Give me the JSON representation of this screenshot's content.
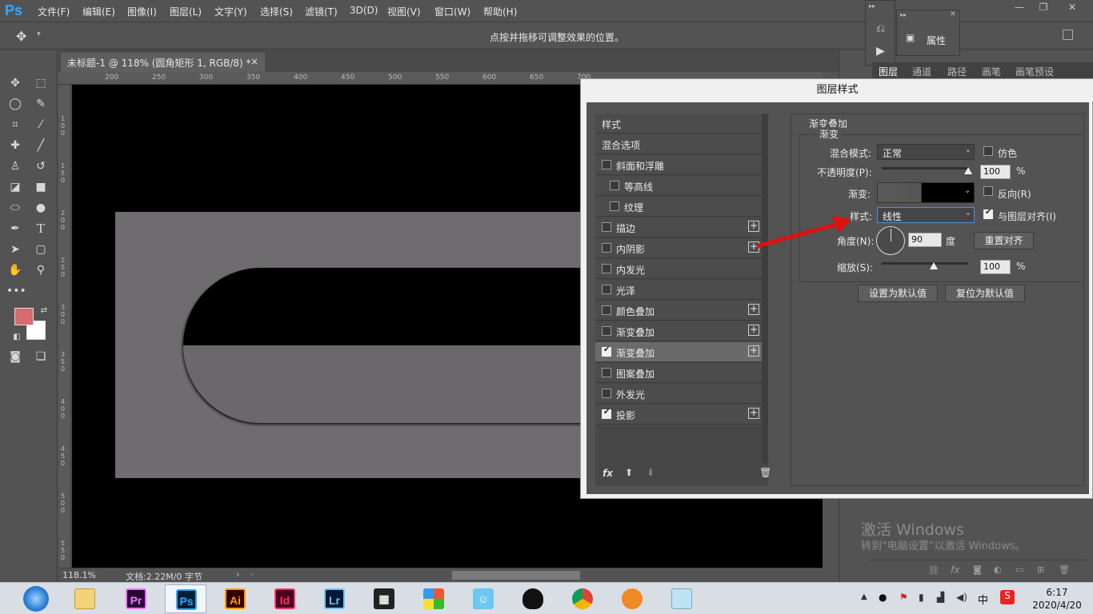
{
  "app": {
    "logo": "Ps"
  },
  "menu": [
    "文件(F)",
    "编辑(E)",
    "图像(I)",
    "图层(L)",
    "文字(Y)",
    "选择(S)",
    "滤镜(T)",
    "3D(D)",
    "视图(V)",
    "窗口(W)",
    "帮助(H)"
  ],
  "options_bar": {
    "hint": "点按并拖移可调整效果的位置。"
  },
  "document": {
    "tab_title": "未标题-1 @ 118% (圆角矩形 1, RGB/8) *",
    "close": "×"
  },
  "ruler_top": [
    "200",
    "250",
    "300",
    "350",
    "400",
    "450",
    "500",
    "550",
    "600",
    "650",
    "700"
  ],
  "ruler_left": [
    "1\n0\n0",
    "1\n5\n0",
    "2\n0\n0",
    "2\n5\n0",
    "3\n0\n0",
    "3\n5\n0",
    "4\n0\n0",
    "4\n5\n0",
    "5\n0\n0",
    "5\n5\n0"
  ],
  "status": {
    "zoom": "118.1%",
    "doc_info": "文档:2.22M/0 字节"
  },
  "panels": {
    "properties_label": "属性",
    "tabs": [
      "图层",
      "通道",
      "路径",
      "画笔",
      "画笔预设"
    ]
  },
  "dialog": {
    "title": "图层样式",
    "style_list": [
      {
        "label": "样式",
        "checkbox": false,
        "plus": false,
        "indent": 0,
        "checked": false,
        "header": true
      },
      {
        "label": "混合选项",
        "checkbox": false,
        "plus": false,
        "indent": 0,
        "checked": false,
        "header": true
      },
      {
        "label": "斜面和浮雕",
        "checkbox": true,
        "plus": false,
        "indent": 0,
        "checked": false
      },
      {
        "label": "等高线",
        "checkbox": true,
        "plus": false,
        "indent": 1,
        "checked": false
      },
      {
        "label": "纹理",
        "checkbox": true,
        "plus": false,
        "indent": 1,
        "checked": false
      },
      {
        "label": "描边",
        "checkbox": true,
        "plus": true,
        "indent": 0,
        "checked": false
      },
      {
        "label": "内阴影",
        "checkbox": true,
        "plus": true,
        "indent": 0,
        "checked": false
      },
      {
        "label": "内发光",
        "checkbox": true,
        "plus": false,
        "indent": 0,
        "checked": false
      },
      {
        "label": "光泽",
        "checkbox": true,
        "plus": false,
        "indent": 0,
        "checked": false
      },
      {
        "label": "颜色叠加",
        "checkbox": true,
        "plus": true,
        "indent": 0,
        "checked": false
      },
      {
        "label": "渐变叠加",
        "checkbox": true,
        "plus": true,
        "indent": 0,
        "checked": false
      },
      {
        "label": "渐变叠加",
        "checkbox": true,
        "plus": true,
        "indent": 0,
        "checked": true,
        "selected": true
      },
      {
        "label": "图案叠加",
        "checkbox": true,
        "plus": false,
        "indent": 0,
        "checked": false
      },
      {
        "label": "外发光",
        "checkbox": true,
        "plus": false,
        "indent": 0,
        "checked": false
      },
      {
        "label": "投影",
        "checkbox": true,
        "plus": true,
        "indent": 0,
        "checked": true
      }
    ],
    "section_title": "渐变叠加",
    "group_title": "渐变",
    "blend_mode_label": "混合模式:",
    "blend_mode_value": "正常",
    "dither_label": "仿色",
    "opacity_label": "不透明度(P):",
    "opacity_value": "100",
    "opacity_fraction": 1.0,
    "percent": "%",
    "gradient_label": "渐变:",
    "reverse_label": "反向(R)",
    "style_label": "样式:",
    "style_value": "线性",
    "align_label": "与图层对齐(I)",
    "angle_label": "角度(N):",
    "angle_value": "90",
    "degree": "度",
    "reset_align": "重置对齐",
    "scale_label": "缩放(S):",
    "scale_value": "100",
    "scale_fraction": 0.6,
    "set_default": "设置为默认值",
    "reset_default": "复位为默认值",
    "footer_fx": "fx"
  },
  "watermark": {
    "line1": "激活 Windows",
    "line2": "转到“电脑设置”以激活 Windows。"
  },
  "taskbar": {
    "apps": [
      {
        "name": "Pr",
        "color": "#2a0634",
        "fg": "#ea77ff"
      },
      {
        "name": "Ps",
        "color": "#001e36",
        "fg": "#31a8ff",
        "active": true
      },
      {
        "name": "Ai",
        "color": "#330000",
        "fg": "#ff9a00"
      },
      {
        "name": "Id",
        "color": "#49021f",
        "fg": "#ff3366"
      },
      {
        "name": "Lr",
        "color": "#001a33",
        "fg": "#74c0fc"
      }
    ],
    "ime": "中",
    "time": "6:17",
    "date": "2020/4/20"
  }
}
